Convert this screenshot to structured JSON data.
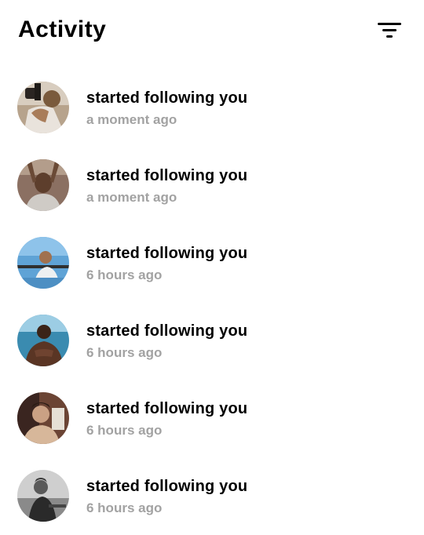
{
  "header": {
    "title": "Activity",
    "filter_icon": "filter-lines-icon"
  },
  "activity": [
    {
      "avatar": "user-avatar",
      "action": "started following you",
      "time": "a moment ago"
    },
    {
      "avatar": "user-avatar",
      "action": "started following you",
      "time": "a moment ago"
    },
    {
      "avatar": "user-avatar",
      "action": "started following you",
      "time": "6 hours ago"
    },
    {
      "avatar": "user-avatar",
      "action": "started following you",
      "time": "6 hours ago"
    },
    {
      "avatar": "user-avatar",
      "action": "started following you",
      "time": "6 hours ago"
    },
    {
      "avatar": "user-avatar",
      "action": "started following you",
      "time": "6 hours ago"
    }
  ],
  "colors": {
    "text_primary": "#000000",
    "text_secondary": "#a2a2a2",
    "background": "#ffffff"
  }
}
